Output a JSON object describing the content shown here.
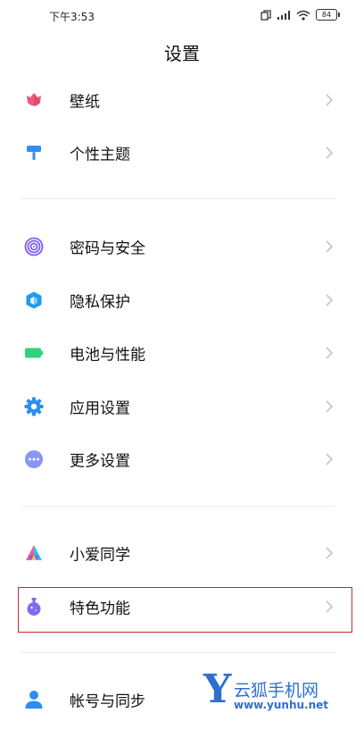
{
  "status_bar": {
    "time": "下午3:53",
    "battery": "84"
  },
  "header": {
    "title": "设置"
  },
  "settings": {
    "wallpaper": {
      "label": "壁纸",
      "icon": "tulip-icon",
      "color": "#f0577a"
    },
    "theme": {
      "label": "个性主题",
      "icon": "paint-roller-icon",
      "color": "#2f8ff0"
    },
    "password_security": {
      "label": "密码与安全",
      "icon": "fingerprint-icon",
      "color": "#7b5cf0"
    },
    "privacy": {
      "label": "隐私保护",
      "icon": "shield-icon",
      "color": "#1e9bf0"
    },
    "battery": {
      "label": "电池与性能",
      "icon": "battery-icon",
      "color": "#2fd47a"
    },
    "app_settings": {
      "label": "应用设置",
      "icon": "gear-icon",
      "color": "#2a8ff0"
    },
    "more_settings": {
      "label": "更多设置",
      "icon": "more-dots-icon",
      "color": "#8a96f4"
    },
    "xiaoai": {
      "label": "小爱同学",
      "icon": "xiaoai-icon",
      "color": "#7c5cf0"
    },
    "special_features": {
      "label": "特色功能",
      "icon": "flask-icon",
      "color": "#7d6cf0"
    },
    "account_sync": {
      "label": "帐号与同步",
      "icon": "person-icon",
      "color": "#2a8ff0"
    }
  },
  "highlight_color": "#c9282f",
  "watermark": {
    "letter": "Y",
    "title": "云狐手机网",
    "url": "www.yunhu.net"
  }
}
